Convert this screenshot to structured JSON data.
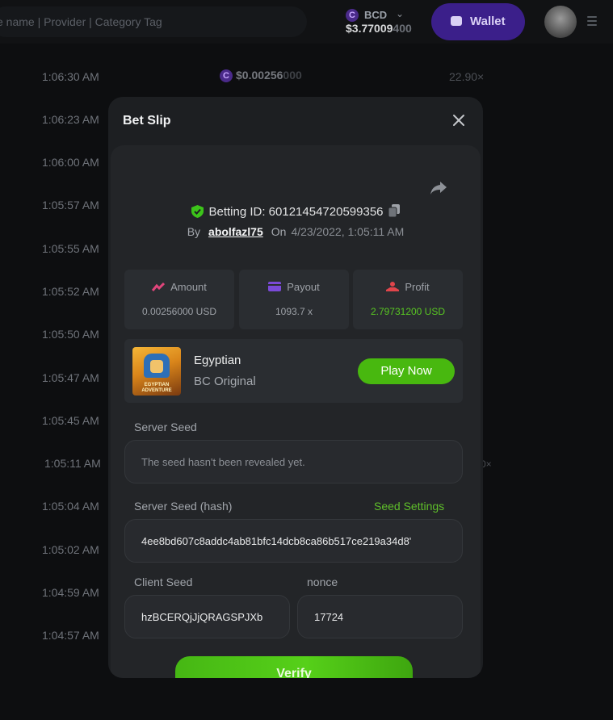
{
  "header": {
    "search_placeholder": "e name | Provider | Category Tag",
    "currency": "BCD",
    "balance_main": "$3.77009",
    "balance_dim": "400",
    "wallet_label": "Wallet"
  },
  "background": {
    "times": [
      "1:06:30 AM",
      "1:06:23 AM",
      "1:06:00 AM",
      "1:05:57 AM",
      "1:05:55 AM",
      "1:05:52 AM",
      "1:05:50 AM",
      "1:05:47 AM",
      "1:05:45 AM",
      "1:05:11 AM",
      "1:05:04 AM",
      "1:05:02 AM",
      "1:04:59 AM",
      "1:04:57 AM"
    ],
    "first_amount_main": "$0.00256",
    "first_amount_dim": "000",
    "first_payout": "22.90×",
    "highlight_payout_fragment": "0×"
  },
  "modal": {
    "title": "Bet Slip",
    "betting_id_label": "Betting ID: 60121454720599356",
    "by_label": "By",
    "username": "abolfazl75",
    "on_label": "On",
    "date": "4/23/2022, 1:05:11 AM",
    "stats": [
      {
        "label": "Amount",
        "value": "0.00256000 USD",
        "icon": "amount-icon",
        "color": "#e0457b"
      },
      {
        "label": "Payout",
        "value": "1093.7 x",
        "icon": "payout-card-icon",
        "color": "#7b4ad8"
      },
      {
        "label": "Profit",
        "value": "2.79731200 USD",
        "icon": "profit-icon",
        "color": "#e0454b"
      }
    ],
    "game": {
      "name": "Egyptian",
      "provider": "BC Original",
      "thumbnail_text": "EGYPTIAN ADVENTURE",
      "play_label": "Play Now"
    },
    "server_seed_label": "Server Seed",
    "server_seed_placeholder": "The seed hasn't been revealed yet.",
    "server_seed_hash_label": "Server Seed (hash)",
    "seed_settings_label": "Seed Settings",
    "server_seed_hash": "4ee8bd607c8addc4ab81bfc14dcb8ca86b517ce219a34d8'",
    "client_seed_label": "Client Seed",
    "client_seed": "hzBCERQjJjQRAGSPJXb",
    "nonce_label": "nonce",
    "nonce": "17724",
    "verify_label": "Verify"
  },
  "colors": {
    "accent_green": "#48b80f",
    "wallet_purple": "#3b1f8a",
    "profit_green": "#58c622"
  }
}
